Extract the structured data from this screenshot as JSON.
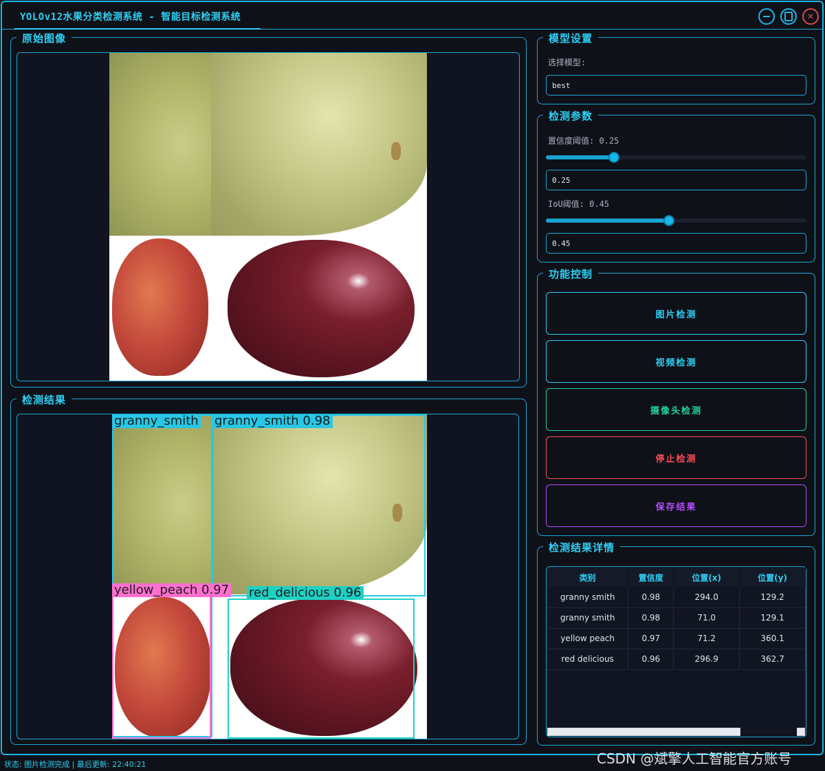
{
  "window": {
    "title": "YOLOv12水果分类检测系统 - 智能目标检测系统"
  },
  "panels": {
    "original": {
      "title": "原始图像"
    },
    "result": {
      "title": "检测结果"
    },
    "model": {
      "title": "模型设置",
      "select_label": "选择模型:",
      "selected_model": "best"
    },
    "params": {
      "title": "检测参数",
      "confidence_label": "置信度阈值: 0.25",
      "confidence_value": "0.25",
      "confidence_level": 0.25,
      "iou_label": "IoU阈值: 0.45",
      "iou_value": "0.45",
      "iou_level": 0.45
    },
    "controls": {
      "title": "功能控制",
      "buttons": [
        {
          "label": "图片检测",
          "color": "#2fd0f5"
        },
        {
          "label": "视频检测",
          "color": "#2fd0f5"
        },
        {
          "label": "摄像头检测",
          "color": "#22d3a3"
        },
        {
          "label": "停止检测",
          "color": "#ff4d5a"
        },
        {
          "label": "保存结果",
          "color": "#b44dff"
        }
      ]
    },
    "details": {
      "title": "检测结果详情",
      "columns": [
        "类别",
        "置信度",
        "位置(x)",
        "位置(y)"
      ],
      "rows": [
        [
          "granny smith",
          "0.98",
          "294.0",
          "129.2"
        ],
        [
          "granny smith",
          "0.98",
          "71.0",
          "129.1"
        ],
        [
          "yellow peach",
          "0.97",
          "71.2",
          "360.1"
        ],
        [
          "red delicious",
          "0.96",
          "296.9",
          "362.7"
        ]
      ]
    }
  },
  "detections": {
    "labels": [
      {
        "text": "granny_smith",
        "color": "#27c8e6"
      },
      {
        "text": "granny_smith 0.98",
        "color": "#27c8e6"
      },
      {
        "text": "yellow_peach 0.97",
        "color": "#ff6fcf"
      },
      {
        "text": "red_delicious 0.96",
        "color": "#1fd1c4"
      }
    ]
  },
  "status": {
    "text": "状态: 图片检测完成 | 最后更新: 22:40:21"
  },
  "watermark": "CSDN @斌擎人工智能官方账号"
}
